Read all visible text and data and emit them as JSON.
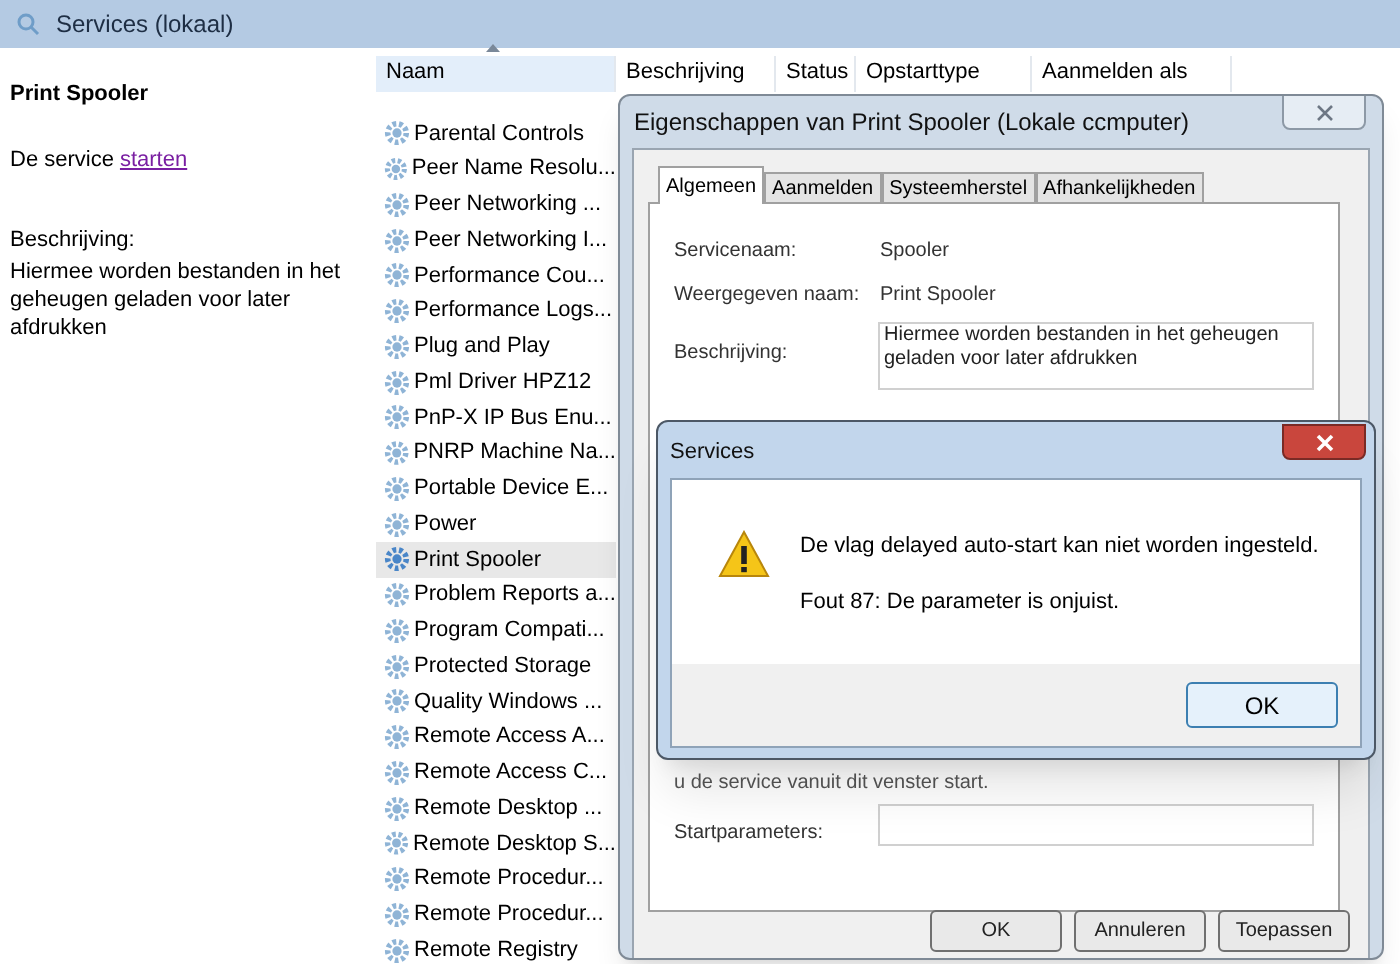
{
  "window": {
    "title": "Services (lokaal)"
  },
  "detail_pane": {
    "service_name": "Print Spooler",
    "action_prefix": "De service",
    "action_link": "starten",
    "description_label": "Beschrijving:",
    "description": "Hiermee worden bestanden in het geheugen geladen voor later afdrukken"
  },
  "services_list": {
    "columns": [
      {
        "label": "Naam",
        "sorted": true
      },
      {
        "label": "Beschrijving",
        "sorted": false
      },
      {
        "label": "Status",
        "sorted": false
      },
      {
        "label": "Opstarttype",
        "sorted": false
      },
      {
        "label": "Aanmelden als",
        "sorted": false
      }
    ],
    "rows": [
      {
        "name": "Parental Controls",
        "selected": false
      },
      {
        "name": "Peer Name Resolu...",
        "selected": false
      },
      {
        "name": "Peer Networking ...",
        "selected": false
      },
      {
        "name": "Peer Networking I...",
        "selected": false
      },
      {
        "name": "Performance Cou...",
        "selected": false
      },
      {
        "name": "Performance Logs...",
        "selected": false
      },
      {
        "name": "Plug and Play",
        "selected": false
      },
      {
        "name": "Pml Driver HPZ12",
        "selected": false
      },
      {
        "name": "PnP-X IP Bus Enu...",
        "selected": false
      },
      {
        "name": "PNRP Machine Na...",
        "selected": false
      },
      {
        "name": "Portable Device E...",
        "selected": false
      },
      {
        "name": "Power",
        "selected": false
      },
      {
        "name": "Print Spooler",
        "selected": true
      },
      {
        "name": "Problem Reports a...",
        "selected": false
      },
      {
        "name": "Program Compati...",
        "selected": false
      },
      {
        "name": "Protected Storage",
        "selected": false
      },
      {
        "name": "Quality Windows ...",
        "selected": false
      },
      {
        "name": "Remote Access A...",
        "selected": false
      },
      {
        "name": "Remote Access C...",
        "selected": false
      },
      {
        "name": "Remote Desktop ...",
        "selected": false
      },
      {
        "name": "Remote Desktop S...",
        "selected": false
      },
      {
        "name": "Remote Procedur...",
        "selected": false
      },
      {
        "name": "Remote Procedur...",
        "selected": false
      },
      {
        "name": "Remote Registry",
        "selected": false
      }
    ]
  },
  "properties_dialog": {
    "title": "Eigenschappen van Print Spooler (Lokale ccmputer)",
    "tabs": [
      {
        "label": "Algemeen",
        "selected": true
      },
      {
        "label": "Aanmelden",
        "selected": false
      },
      {
        "label": "Systeemherstel",
        "selected": false
      },
      {
        "label": "Afhankelijkheden",
        "selected": false
      }
    ],
    "fields": [
      {
        "label": "Servicenaam:",
        "value": "Spooler"
      },
      {
        "label": "Weergegeven naam:",
        "value": "Print Spooler"
      }
    ],
    "description_label": "Beschrijving:",
    "description": "Hiermee worden bestanden in het geheugen geladen voor later afdrukken",
    "partial_text": "u de service vanuit dit venster start.",
    "start_parameters_label": "Startparameters:",
    "buttons": [
      "OK",
      "Annuleren",
      "Toepassen"
    ]
  },
  "error_dialog": {
    "title": "Services",
    "message": "De vlag delayed auto-start kan niet worden ingesteld.",
    "detail": "Fout 87: De parameter is onjuist.",
    "button": "OK"
  }
}
